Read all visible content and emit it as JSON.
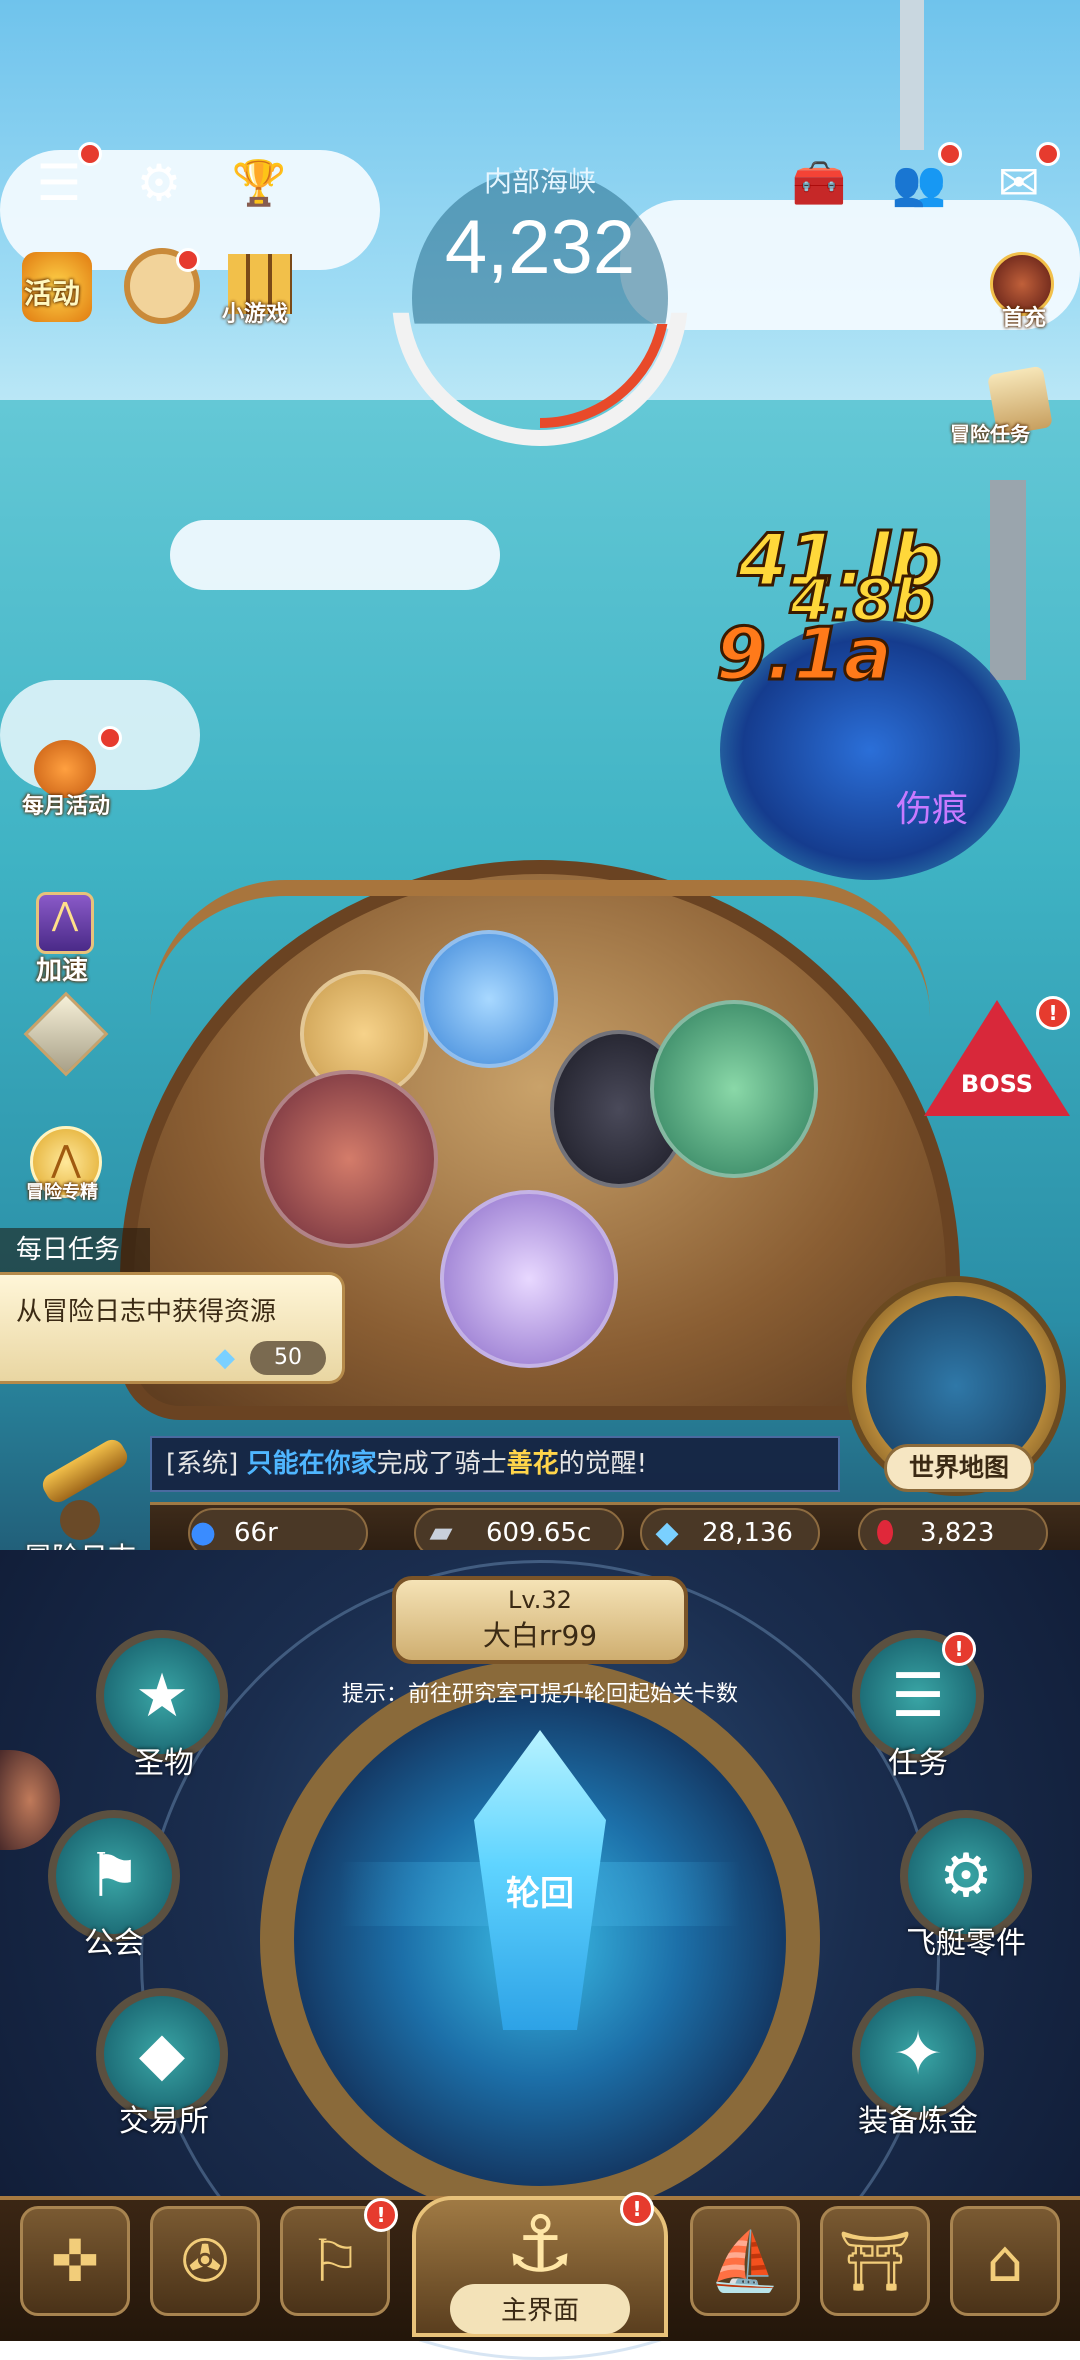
{
  "top": {
    "stage_name": "内部海峡",
    "stage_count": "4,232",
    "left_icons": [
      {
        "name": "menu-icon",
        "glyph": "☰"
      },
      {
        "name": "gear-icon",
        "glyph": "⚙"
      },
      {
        "name": "trophy-icon",
        "glyph": "🏆"
      }
    ],
    "right_icons": [
      {
        "name": "toolbox-icon",
        "glyph": "🧰"
      },
      {
        "name": "friends-icon",
        "glyph": "👥"
      },
      {
        "name": "mail-icon",
        "glyph": "✉"
      }
    ]
  },
  "left_icons": {
    "activity_label": "活动",
    "helm_label": "",
    "minigame_label": "小游戏",
    "monthly_label": "每月活动",
    "speedup_label": "加速",
    "adventure_special_label": "冒险专精"
  },
  "right_icons": {
    "first_recharge_label": "首充",
    "adventure_task_label": "冒险任务"
  },
  "battle": {
    "damage_1": "41.lb",
    "damage_2": "4.8b",
    "damage_3": "9.1a",
    "status_text": "伤痕",
    "boss_label": "BOSS"
  },
  "daily_task": {
    "tag": "每日任务",
    "text": "从冒险日志中获得资源",
    "reward": "50"
  },
  "system_message": {
    "prefix": "[系统] ",
    "player": "只能在你家",
    "middle": "完成了骑士",
    "knight": "善花",
    "suffix": "的觉醒!"
  },
  "world_map": {
    "label": "世界地图"
  },
  "adventure_log": {
    "label": "冒险日志"
  },
  "resources": [
    {
      "name": "spirit",
      "value": "66r",
      "color": "#3a8cff"
    },
    {
      "name": "silver-bar",
      "value": "609.65c",
      "color": "#c8d0dc"
    },
    {
      "name": "diamond",
      "value": "28,136",
      "color": "#7ad0ff"
    },
    {
      "name": "ruby",
      "value": "3,823",
      "color": "#e0283a"
    }
  ],
  "player": {
    "level": "Lv.32",
    "name": "大白rr99"
  },
  "hint": "提示：前往研究室可提升轮回起始关卡数",
  "dial": {
    "label": "轮回"
  },
  "functions": {
    "relic": "圣物",
    "guild": "公会",
    "exchange": "交易所",
    "task": "任务",
    "airship_parts": "飞艇零件",
    "equip_alchemy": "装备炼金"
  },
  "nav": {
    "main_label": "主界面"
  },
  "colors": {
    "accent_gold": "#e8c27a",
    "alert_red": "#e63b2e",
    "teal": "#2a8a96"
  }
}
